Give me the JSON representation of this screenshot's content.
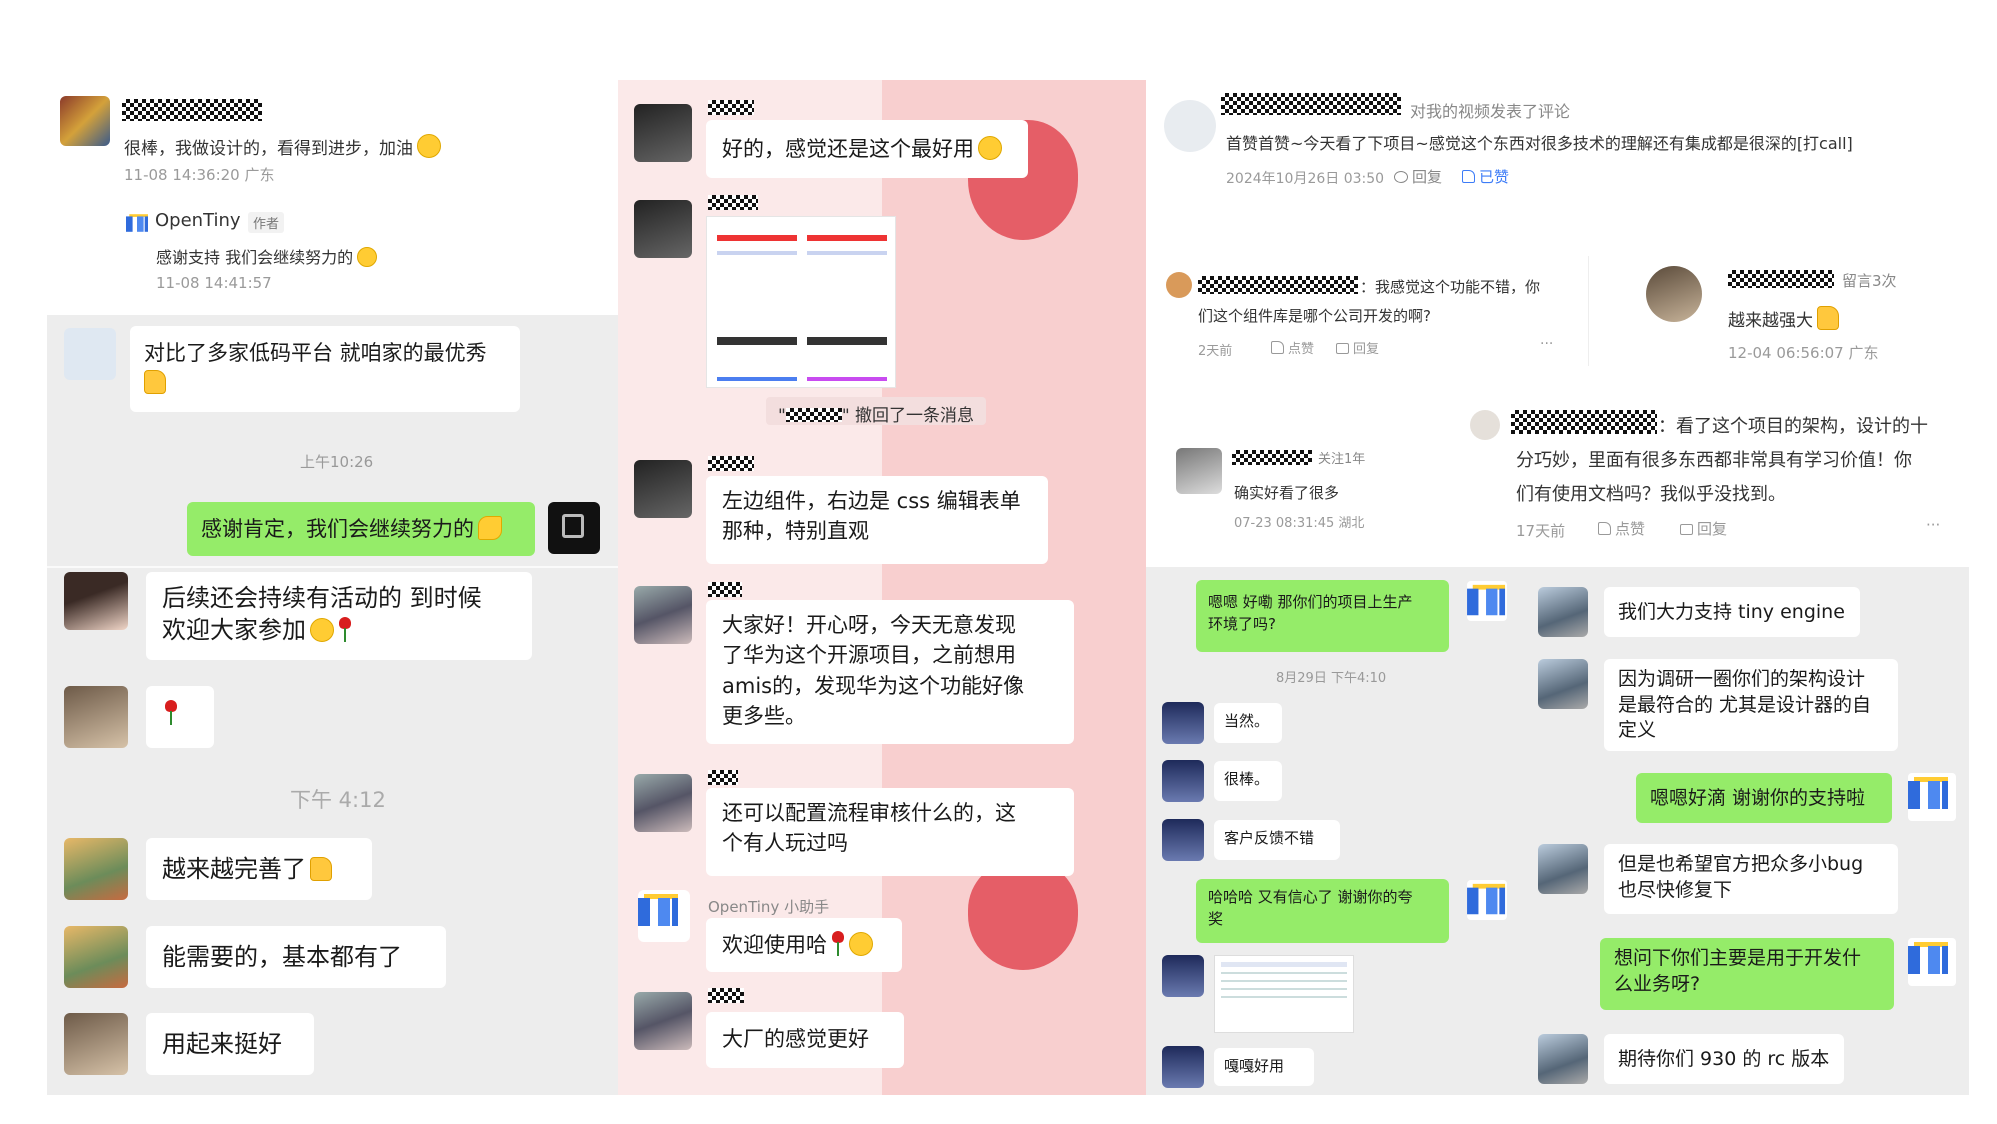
{
  "p1": {
    "c1_text": "很棒，我做设计的，看得到进步，加油",
    "c1_time": "11-08 14:36:20 广东",
    "author_name": "OpenTiny",
    "author_tag": "作者",
    "reply_text": "感谢支持 我们会继续努力的",
    "reply_time": "11-08 14:41:57",
    "m1_line1": "对比了多家低码平台 就咱家的最优秀",
    "time1": "上午10:26",
    "m2": "感谢肯定，我们会继续努力的",
    "m3_line1": "后续还会持续有活动的 到时候",
    "m3_line2": "欢迎大家参加",
    "time2": "下午 4:12",
    "m5": "越来越完善了",
    "m6": "能需要的，基本都有了",
    "m7": "用起来挺好"
  },
  "p2": {
    "m1": "好的，感觉还是这个最好用",
    "recall": "\" 撤回了一条消息",
    "m2_line1": "左边组件，右边是 css 编辑表单",
    "m2_line2": "那种，特别直观",
    "m3_line1": "大家好！开心呀，今天无意发现",
    "m3_line2": "了华为这个开源项目，之前想用",
    "m3_line3": "amis的，发现华为这个功能好像",
    "m3_line4": "更多些。",
    "m4_line1": "还可以配置流程审核什么的，这",
    "m4_line2": "个有人玩过吗",
    "helper_name": "OpenTiny 小助手",
    "m5": "欢迎使用哈",
    "m6": "大厂的感觉更好"
  },
  "p3": {
    "action": "对我的视频发表了评论",
    "comment": "首赞首赞~今天看了下项目~感觉这个东西对很多技术的理解还有集成都是很深的[打call]",
    "date": "2024年10月26日 03:50",
    "reply": "回复",
    "liked": "已赞",
    "q1_line1": "：我感觉这个功能不错，你",
    "q1_line2": "们这个组件库是哪个公司开发的啊?",
    "q1_time": "2天前",
    "like": "点赞",
    "more": "···",
    "q2_tag": "留言3次",
    "q2_text": "越来越强大",
    "q2_time": "12-04 06:56:07 广东",
    "q3_line1": "：看了这个项目的架构，设计的十",
    "q3_line2": "分巧妙，里面有很多东西都非常具有学习价值！你",
    "q3_line3": "们有使用文档吗？我似乎没找到。",
    "q3_time": "17天前",
    "q4_tag": "关注1年",
    "q4_text": "确实好看了很多",
    "q4_time": "07-23 08:31:45 湖北"
  },
  "p4": {
    "m1_line1": "嗯嗯 好嘞 那你们的项目上生产",
    "m1_line2": "环境了吗?",
    "time": "8月29日 下午4:10",
    "m2": "当然。",
    "m3": "很棒。",
    "m4": "客户反馈不错",
    "m5_line1": "哈哈哈 又有信心了 谢谢你的夸",
    "m5_line2": "奖",
    "m6": "嘎嘎好用"
  },
  "p5": {
    "m1": "我们大力支持 tiny engine",
    "m2_line1": "因为调研一圈你们的架构设计",
    "m2_line2": "是最符合的 尤其是设计器的自",
    "m2_line3": "定义",
    "m3": "嗯嗯好滴 谢谢你的支持啦",
    "m4_line1": "但是也希望官方把众多小bug",
    "m4_line2": "也尽快修复下",
    "m5_line1": "想问下你们主要是用于开发什",
    "m5_line2": "么业务呀?",
    "m6": "期待你们 930 的 rc 版本"
  },
  "colors": {
    "wechat_green": "#95ec69",
    "chat_gray": "#ededed",
    "link_blue": "#3d7cf7",
    "pink": "#fbd8d8"
  }
}
